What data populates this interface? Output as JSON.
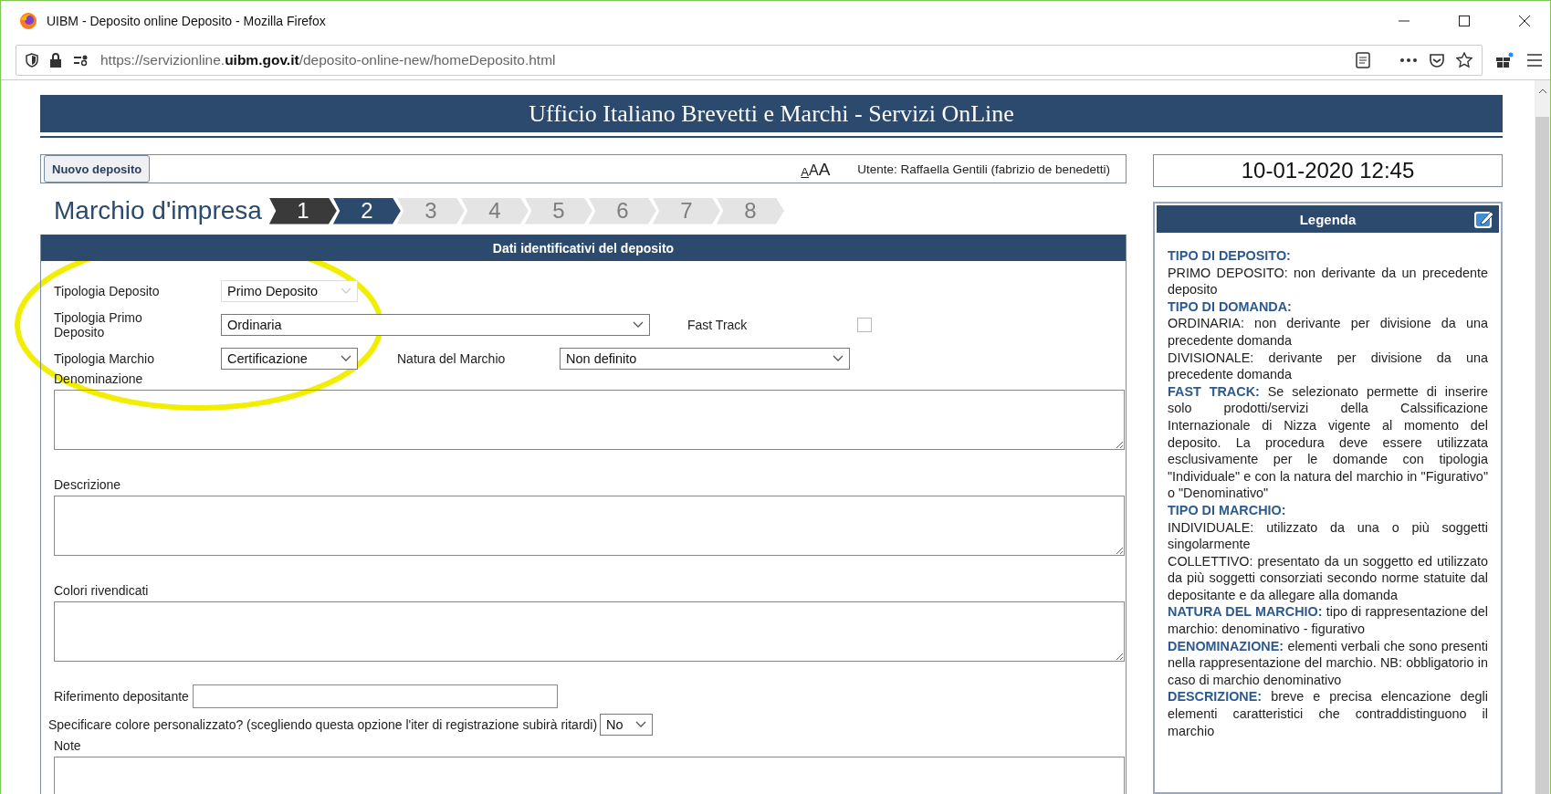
{
  "window": {
    "title": "UIBM - Deposito online Deposito - Mozilla Firefox"
  },
  "url": "https://servizionline.**uibm.gov.it**/deposito-online-new/homeDeposito.html",
  "header": {
    "title": "Ufficio Italiano Brevetti e Marchi - Servizi OnLine"
  },
  "toolbar": {
    "new_button": "Nuovo deposito",
    "font_sizes": [
      "A",
      "A",
      "A"
    ],
    "user": "Utente: Raffaella Gentili (fabrizio de benedetti)"
  },
  "datetime": "10-01-2020 12:45",
  "page_title": "Marchio d'impresa",
  "steps": [
    {
      "label": "1",
      "done": true,
      "selected": false
    },
    {
      "label": "2",
      "done": false,
      "selected": true
    },
    {
      "label": "3",
      "done": false,
      "selected": false
    },
    {
      "label": "4",
      "done": false,
      "selected": false
    },
    {
      "label": "5",
      "done": false,
      "selected": false
    },
    {
      "label": "6",
      "done": false,
      "selected": false
    },
    {
      "label": "7",
      "done": false,
      "selected": false
    },
    {
      "label": "8",
      "done": false,
      "selected": false
    }
  ],
  "form": {
    "title": "Dati identificativi del deposito",
    "deposit_type": {
      "label": "Tipologia Deposito",
      "value": "Primo Deposito",
      "disabled": true
    },
    "first_deposit_type": {
      "label": "Tipologia Primo Deposito",
      "value": "Ordinaria",
      "disabled": false
    },
    "fast_track": {
      "label": "Fast Track",
      "checked": false
    },
    "mark_type": {
      "label": "Tipologia Marchio",
      "value": "Certificazione",
      "disabled": false
    },
    "mark_nature": {
      "label": "Natura del Marchio",
      "value": "Non definito",
      "disabled": false
    },
    "text_areas": [
      {
        "label": "Denominazione"
      },
      {
        "label": "Descrizione"
      },
      {
        "label": "Colori rivendicati"
      }
    ],
    "reference": {
      "label": "Riferimento depositante"
    },
    "custom_color": {
      "label": "Specificare colore personalizzato? (scegliendo questa opzione l'iter di registrazione subirà ritardi)",
      "value": "No",
      "disabled": false
    },
    "notes": {
      "label": "Note"
    }
  },
  "legend": {
    "title": "Legenda",
    "entries": [
      {
        "heading": "TIPO DI DEPOSITO:"
      },
      {
        "text": "PRIMO DEPOSITO: non derivante da un precedente deposito"
      },
      {
        "heading": "TIPO DI DOMANDA:"
      },
      {
        "text": "ORDINARIA: non derivante per divisione da una precedente domanda"
      },
      {
        "text": "DIVISIONALE: derivante per divisione da una precedente domanda"
      },
      {
        "heading": "FAST TRACK:",
        "text": "Se selezionato permette di inserire solo prodotti/servizi della Calssificazione Internazionale di Nizza vigente al momento del deposito. La procedura deve essere utilizzata esclusivamente per le domande con tipologia \"Individuale\" e con la natura del marchio in \"Figurativo\" o \"Denominativo\""
      },
      {
        "heading": "TIPO DI MARCHIO:"
      },
      {
        "text": "INDIVIDUALE: utilizzato da una o più soggetti singolarmente"
      },
      {
        "text": "COLLETTIVO: presentato da un soggetto ed utilizzato da più soggetti consorziati secondo norme statuite dal depositante e da allegare alla domanda"
      },
      {
        "heading": "NATURA DEL MARCHIO:",
        "text": "tipo di rappresentazione del marchio: denominativo - figurativo"
      },
      {
        "heading": "DENOMINAZIONE:",
        "text": "elementi verbali che sono presenti nella rappresentazione del marchio. NB: obbligatorio in caso di marchio denominativo"
      },
      {
        "heading": "DESCRIZIONE:",
        "text": "breve e precisa elencazione degli elementi caratteristici che contraddistinguono il marchio"
      }
    ]
  }
}
